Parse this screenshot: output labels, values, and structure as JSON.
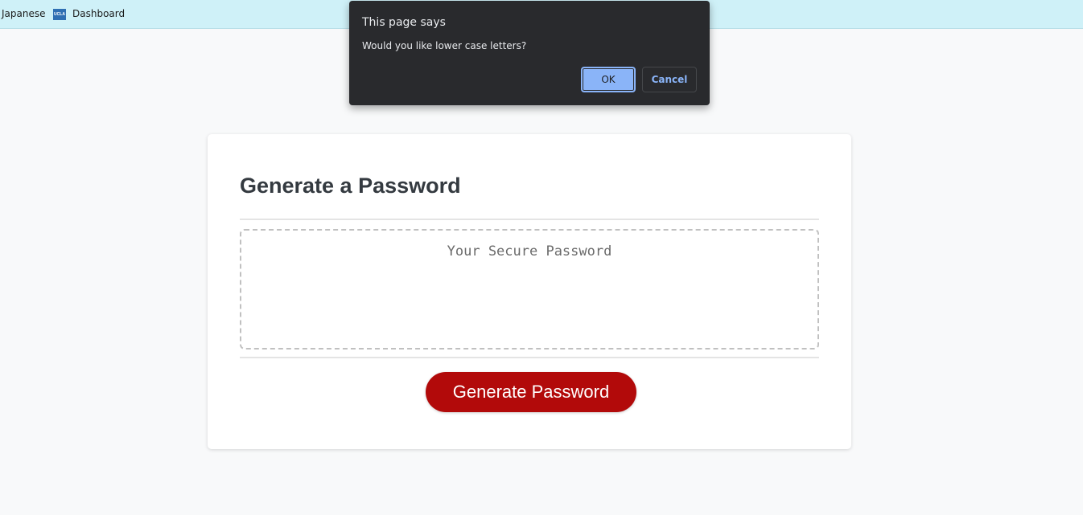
{
  "bookmarks": {
    "items": [
      {
        "label": "Japanese"
      },
      {
        "label": "Dashboard",
        "icon": "ucla-icon",
        "icon_text": "UCLA"
      }
    ]
  },
  "card": {
    "title": "Generate a Password",
    "password_placeholder": "Your Secure Password",
    "generate_button": "Generate Password"
  },
  "dialog": {
    "title": "This page says",
    "message": "Would you like lower case letters?",
    "ok_label": "OK",
    "cancel_label": "Cancel"
  },
  "colors": {
    "accent_button": "#b20a0a",
    "bookmarks_bar": "#cff1f8",
    "dialog_bg": "#292a2d",
    "dialog_ok": "#8ab4f8"
  }
}
